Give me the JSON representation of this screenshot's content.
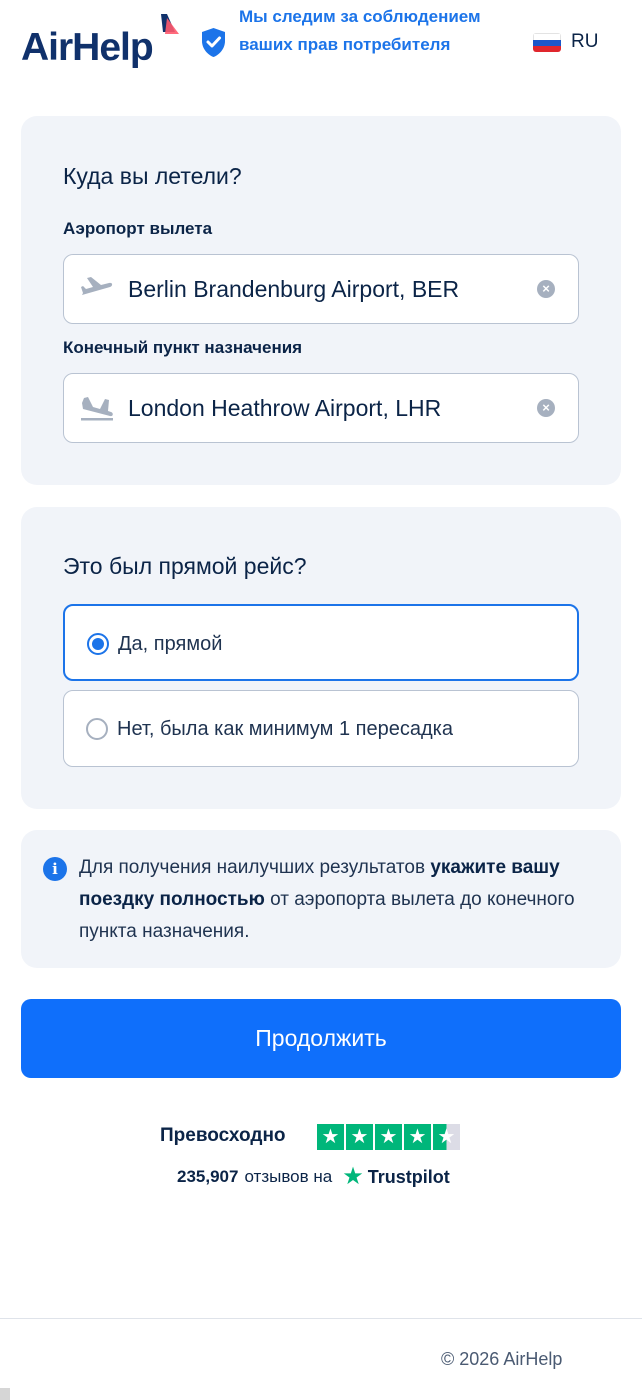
{
  "header": {
    "logo_text": "AirHelp",
    "promise": "Мы следим за соблюдением ваших прав потребителя",
    "language": "RU"
  },
  "flight_card": {
    "title": "Куда вы летели?",
    "departure_label": "Аэропорт вылета",
    "departure_value": "Berlin Brandenburg Airport, BER",
    "destination_label": "Конечный пункт назначения",
    "destination_value": "London Heathrow Airport, LHR"
  },
  "direct_card": {
    "title": "Это был прямой рейс?",
    "options": [
      {
        "label": "Да, прямой",
        "selected": true
      },
      {
        "label": "Нет, была как минимум 1 пересадка",
        "selected": false
      }
    ]
  },
  "info": {
    "text_before": "Для получения наилучших результатов ",
    "text_bold": "укажите вашу поездку полностью",
    "text_after": " от аэропорта вылета до конечного пункта назначения."
  },
  "continue_button": "Продолжить",
  "trustpilot": {
    "rating_word": "Превосходно",
    "stars": 4.5,
    "review_count": "235,907",
    "reviews_on": "отзывов на",
    "brand": "Trustpilot"
  },
  "footer": {
    "copyright": "© 2026 AirHelp"
  },
  "colors": {
    "accent": "#0f6ffb",
    "link_blue": "#1c74e9",
    "navy": "#0b2447",
    "card_bg": "#f1f4f9",
    "trustpilot_green": "#00b67a"
  }
}
